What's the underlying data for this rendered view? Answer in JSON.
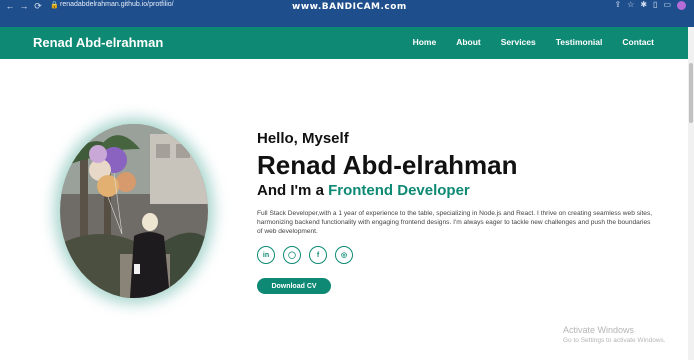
{
  "browser": {
    "url": "renadabdelrahman.github.io/protfilio/",
    "watermark": "www.BANDICAM.com",
    "back_glyph": "←",
    "forward_glyph": "→",
    "reload_glyph": "⟳",
    "lock_glyph": "🔒",
    "tool_glyphs": [
      "⇪",
      "☆",
      "✱",
      "▯",
      "▭"
    ]
  },
  "header": {
    "brand": "Renad Abd-elrahman",
    "nav": [
      "Home",
      "About",
      "Services",
      "Testimonial",
      "Contact"
    ]
  },
  "hero": {
    "greeting": "Hello, Myself",
    "name": "Renad Abd-elrahman",
    "role_prefix": "And I'm a ",
    "role": "Frontend Developer",
    "bio": "Full Stack Developer,with a 1 year of experience to the table, specializing in Node.js and React. I thrive on creating seamless web sites, harmonizing backend functionality with engaging frontend designs. I'm always eager to tackle new challenges and push the boundaries of web development.",
    "socials": [
      {
        "icon": "linkedin-icon",
        "glyph": "in"
      },
      {
        "icon": "github-icon",
        "glyph": "◯"
      },
      {
        "icon": "facebook-icon",
        "glyph": "f"
      },
      {
        "icon": "instagram-icon",
        "glyph": "◎"
      }
    ],
    "cta_label": "Download CV"
  },
  "os_overlay": {
    "title": "Activate Windows",
    "subtitle": "Go to Settings to activate Windows."
  },
  "colors": {
    "accent": "#0e8a74",
    "chrome": "#1f4e8c"
  }
}
